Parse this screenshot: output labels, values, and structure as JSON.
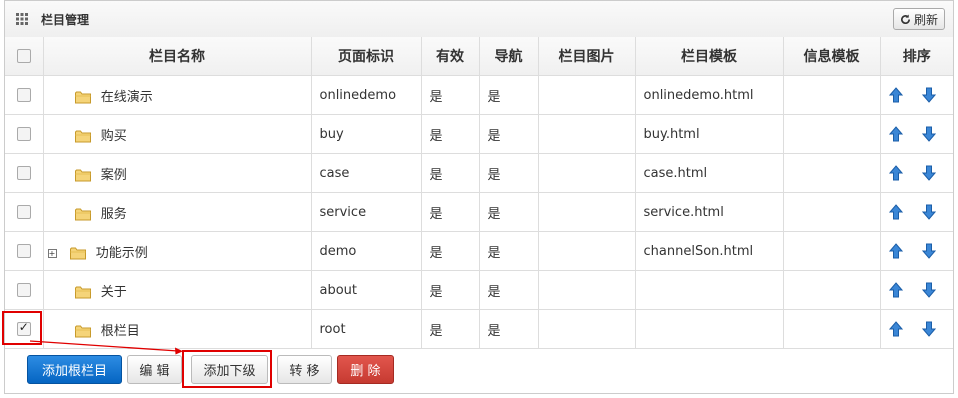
{
  "header": {
    "title": "栏目管理",
    "refresh_label": "刷新"
  },
  "columns": [
    "栏目名称",
    "页面标识",
    "有效",
    "导航",
    "栏目图片",
    "栏目模板",
    "信息模板",
    "排序"
  ],
  "rows": [
    {
      "name": "在线演示",
      "ident": "onlinedemo",
      "valid": "是",
      "nav": "是",
      "image": "",
      "template": "onlinedemo.html",
      "info": "",
      "expandable": false,
      "checked": false
    },
    {
      "name": "购买",
      "ident": "buy",
      "valid": "是",
      "nav": "是",
      "image": "",
      "template": "buy.html",
      "info": "",
      "expandable": false,
      "checked": false
    },
    {
      "name": "案例",
      "ident": "case",
      "valid": "是",
      "nav": "是",
      "image": "",
      "template": "case.html",
      "info": "",
      "expandable": false,
      "checked": false
    },
    {
      "name": "服务",
      "ident": "service",
      "valid": "是",
      "nav": "是",
      "image": "",
      "template": "service.html",
      "info": "",
      "expandable": false,
      "checked": false
    },
    {
      "name": "功能示例",
      "ident": "demo",
      "valid": "是",
      "nav": "是",
      "image": "",
      "template": "channelSon.html",
      "info": "",
      "expandable": true,
      "checked": false
    },
    {
      "name": "关于",
      "ident": "about",
      "valid": "是",
      "nav": "是",
      "image": "",
      "template": "",
      "info": "",
      "expandable": false,
      "checked": false
    },
    {
      "name": "根栏目",
      "ident": "root",
      "valid": "是",
      "nav": "是",
      "image": "",
      "template": "",
      "info": "",
      "expandable": false,
      "checked": true
    }
  ],
  "footer": {
    "add_root": "添加根栏目",
    "edit": "编 辑",
    "add_child": "添加下级",
    "move": "转 移",
    "delete": "删 除"
  },
  "colors": {
    "primary": "#0a6fd1",
    "danger": "#d9443b",
    "highlight": "#e00000",
    "arrow": "#1f6fc7"
  }
}
